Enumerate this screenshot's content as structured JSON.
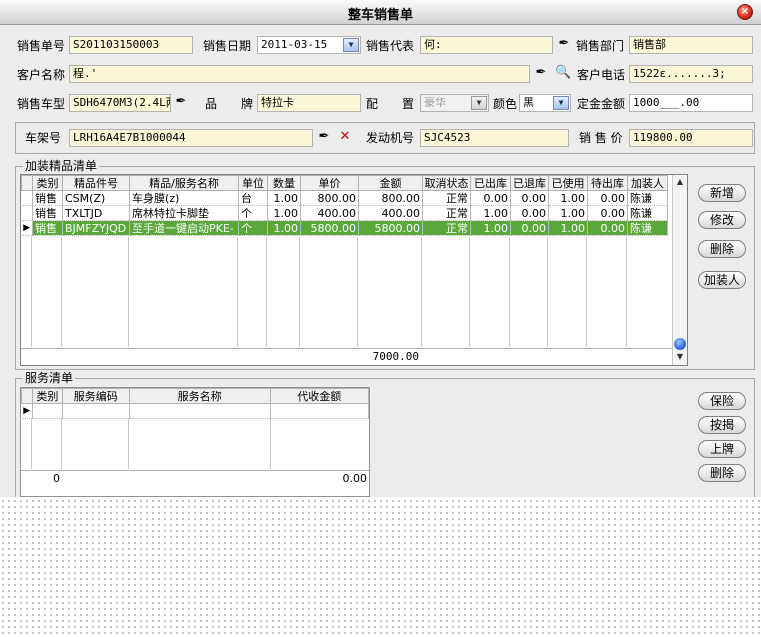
{
  "window": {
    "title": "整车销售单",
    "close_symbol": "×"
  },
  "header": {
    "order_no_label": "销售单号",
    "order_no": "S201103150003",
    "date_label": "销售日期",
    "date": "2011-03-15",
    "rep_label": "销售代表",
    "rep": "何:",
    "dept_label": "销售部门",
    "dept": "销售部",
    "customer_label": "客户名称",
    "customer": "程.'",
    "phone_label": "客户电话",
    "phone": "1522ε.......3;",
    "model_label": "销售车型",
    "model": "SDH6470M3(2.4L两",
    "brand_label": "品　　牌",
    "brand": "特拉卡",
    "config_label": "配　　置",
    "config": "豪华",
    "color_label": "颜色",
    "color": "黑",
    "deposit_label": "定金金额",
    "deposit": "1000___.00",
    "frame_label": "车架号",
    "frame": "LRH16A4E7B1000044",
    "engine_label": "发动机号",
    "engine": "SJC4523",
    "price_label": "销 售 价",
    "price": "119800.00"
  },
  "accessories": {
    "section_title": "加装精品清单",
    "columns": [
      "类别",
      "精品件号",
      "精品/服务名称",
      "单位",
      "数量",
      "单价",
      "金额",
      "取消状态",
      "已出库",
      "已退库",
      "已使用",
      "待出库",
      "加装人"
    ],
    "rows": [
      {
        "type": "销售",
        "part_no": "CSM(Z)",
        "name": "车身膜(z)",
        "unit": "台",
        "qty": "1.00",
        "unit_price": "800.00",
        "amount": "800.00",
        "cancel_status": "正常",
        "out": "0.00",
        "returned": "0.00",
        "used": "1.00",
        "pending": "0.00",
        "installer": "陈谦"
      },
      {
        "type": "销售",
        "part_no": "TXLTJD",
        "name": "席林特拉卡脚垫",
        "unit": "个",
        "qty": "1.00",
        "unit_price": "400.00",
        "amount": "400.00",
        "cancel_status": "正常",
        "out": "1.00",
        "returned": "0.00",
        "used": "1.00",
        "pending": "0.00",
        "installer": "陈谦"
      },
      {
        "type": "销售",
        "part_no": "BJMFZYJQD",
        "name": "至手道一键启动PKE-",
        "unit": "个",
        "qty": "1.00",
        "unit_price": "5800.00",
        "amount": "5800.00",
        "cancel_status": "正常",
        "out": "1.00",
        "returned": "0.00",
        "used": "1.00",
        "pending": "0.00",
        "installer": "陈谦"
      }
    ],
    "selected_row": 2,
    "total_amount": "7000.00",
    "buttons": {
      "add": "新增",
      "edit": "修改",
      "delete": "删除",
      "installer": "加装人"
    }
  },
  "services": {
    "section_title": "服务清单",
    "columns": [
      "类别",
      "服务编码",
      "服务名称",
      "代收金额"
    ],
    "footer_count": "0",
    "footer_amount": "0.00",
    "buttons": {
      "insurance": "保险",
      "mortgage": "按揭",
      "plate": "上牌",
      "delete": "删除"
    }
  },
  "colors": {
    "selected_row": "#5aa83c",
    "field_bg": "#fbf6d6",
    "panel_bg": "#ececec"
  },
  "icons": [
    "pen-icon",
    "lookup-icon",
    "close-x-icon",
    "dropdown-icon"
  ]
}
